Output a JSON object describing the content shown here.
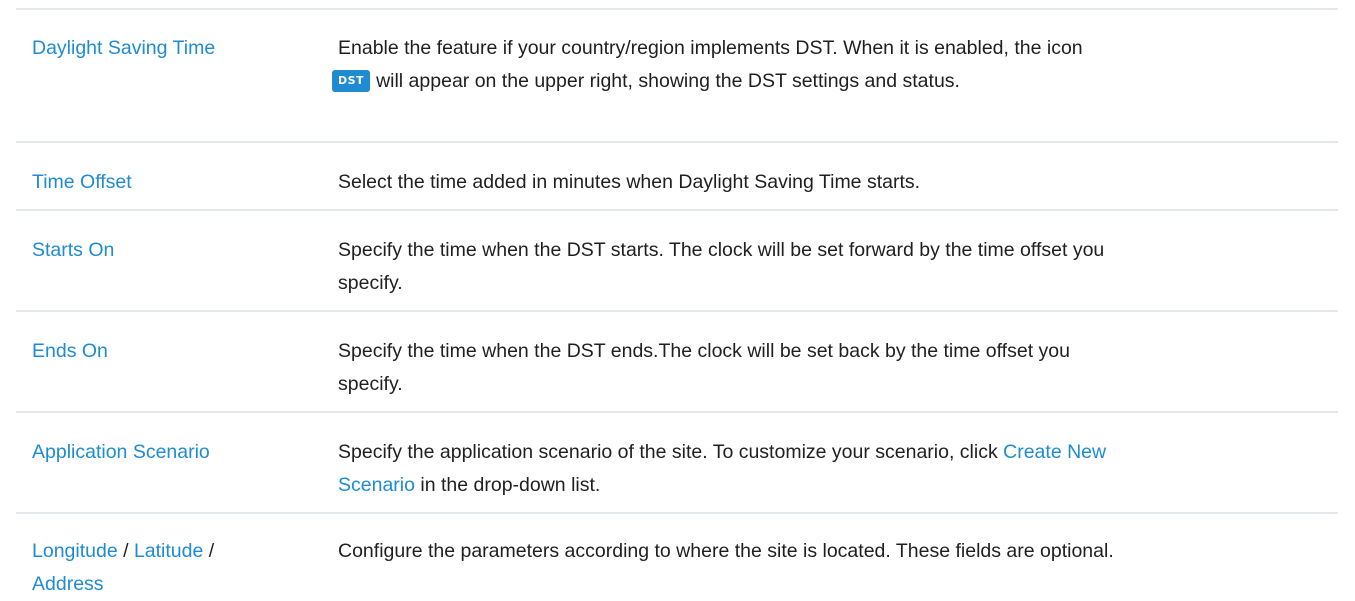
{
  "rows": [
    {
      "term": "Daylight Saving Time",
      "desc_before_icon": "Enable the feature if your country/region implements DST. When it is enabled, the icon",
      "icon_label": "DST",
      "desc_after_icon": "will appear on the upper right, showing the DST settings and status."
    },
    {
      "term": "Time Offset",
      "desc": "Select the time added in minutes when Daylight Saving Time starts."
    },
    {
      "term": "Starts On",
      "desc_line1": "Specify the time when the DST starts. The clock will be set forward by the time offset you",
      "desc_line2": "specify."
    },
    {
      "term": "Ends On",
      "desc_line1": "Specify the time when the DST ends.The clock will be set back by the time offset you",
      "desc_line2": "specify."
    },
    {
      "term": "Application Scenario",
      "desc_line1_before": "Specify the application scenario of the site. To customize your scenario, click",
      "desc_link1": "Create New",
      "desc_link2": "Scenario",
      "desc_line2_after": "in the drop-down list."
    },
    {
      "term_parts": [
        "Longitude",
        "Latitude",
        "Address"
      ],
      "term_sep": "/",
      "desc": "Configure the parameters according to where the site is located. These fields are optional."
    }
  ],
  "colors": {
    "link": "#1e8bd2",
    "text": "#1f1f1f",
    "divider": "#e4e8ee",
    "badge_bg": "#1e8bd2"
  }
}
